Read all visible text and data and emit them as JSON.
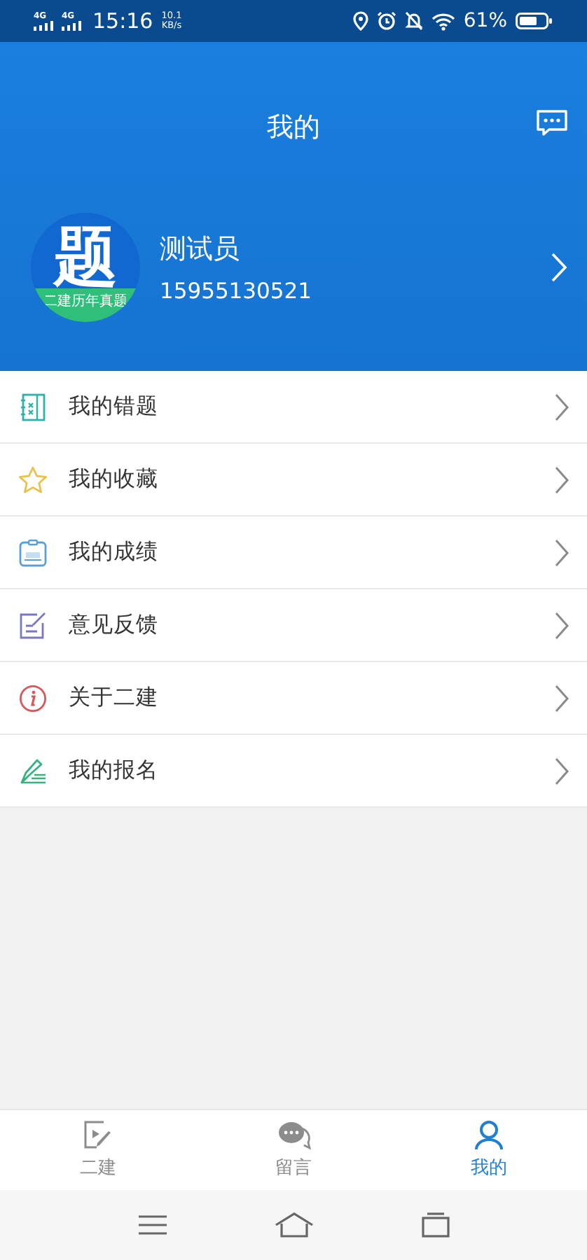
{
  "status_bar": {
    "network_1": "4G",
    "network_2": "4G",
    "time": "15:16",
    "speed_value": "10.1",
    "speed_unit": "KB/s",
    "battery": "61%"
  },
  "header": {
    "title": "我的"
  },
  "profile": {
    "avatar_glyph": "题",
    "avatar_caption": "二建历年真题",
    "name": "测试员",
    "phone": "15955130521"
  },
  "menu": [
    {
      "kind": "notebook",
      "label": "我的错题"
    },
    {
      "kind": "star",
      "label": "我的收藏"
    },
    {
      "kind": "score",
      "label": "我的成绩"
    },
    {
      "kind": "feedback",
      "label": "意见反馈"
    },
    {
      "kind": "info",
      "label": "关于二建"
    },
    {
      "kind": "signup",
      "label": "我的报名"
    }
  ],
  "tabs": [
    {
      "kind": "video",
      "label": "二建",
      "selected": false
    },
    {
      "kind": "chat",
      "label": "留言",
      "selected": false
    },
    {
      "kind": "person",
      "label": "我的",
      "selected": true
    }
  ]
}
